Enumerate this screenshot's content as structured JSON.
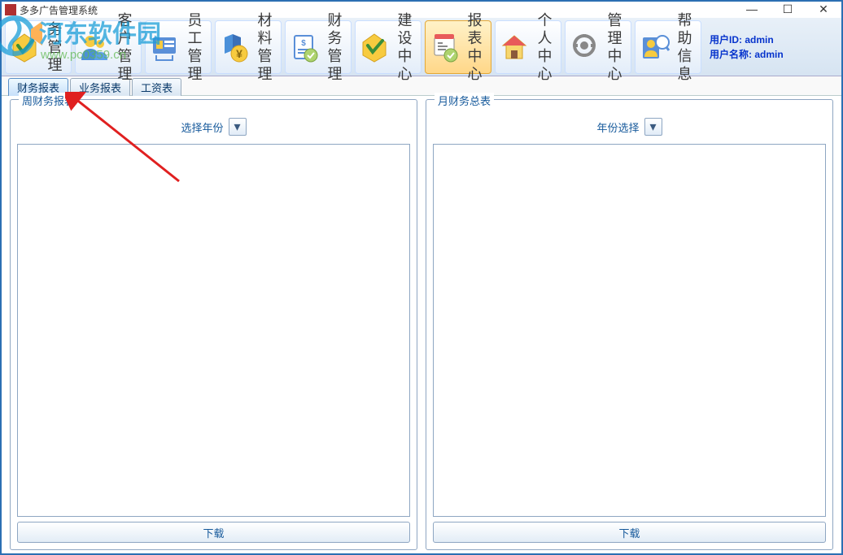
{
  "window": {
    "title": "多多广告管理系统"
  },
  "toolbar": {
    "items": [
      {
        "line1": "务",
        "line2": "管 理"
      },
      {
        "line1": "客 户",
        "line2": "管 理"
      },
      {
        "line1": "员 工",
        "line2": "管 理"
      },
      {
        "line1": "材 料",
        "line2": "管 理"
      },
      {
        "line1": "财 务",
        "line2": "管 理"
      },
      {
        "line1": "建 设",
        "line2": "中 心"
      },
      {
        "line1": "报 表",
        "line2": "中 心"
      },
      {
        "line1": "个 人",
        "line2": "中 心"
      },
      {
        "line1": "管 理",
        "line2": "中 心"
      },
      {
        "line1": "帮 助",
        "line2": "信 息"
      }
    ]
  },
  "user": {
    "id_label": "用户ID: ",
    "id_value": "admin",
    "name_label": "用户名称: ",
    "name_value": "admin"
  },
  "tabs": [
    {
      "label": "财务报表"
    },
    {
      "label": "业务报表"
    },
    {
      "label": "工资表"
    }
  ],
  "panels": {
    "left": {
      "title": "周财务报表",
      "selector_label": "选择年份",
      "download_label": "下载"
    },
    "right": {
      "title": "月财务总表",
      "selector_label": "年份选择",
      "download_label": "下载"
    }
  },
  "watermark": {
    "text": "河东软件园",
    "url": "www.pc0359.cn"
  }
}
